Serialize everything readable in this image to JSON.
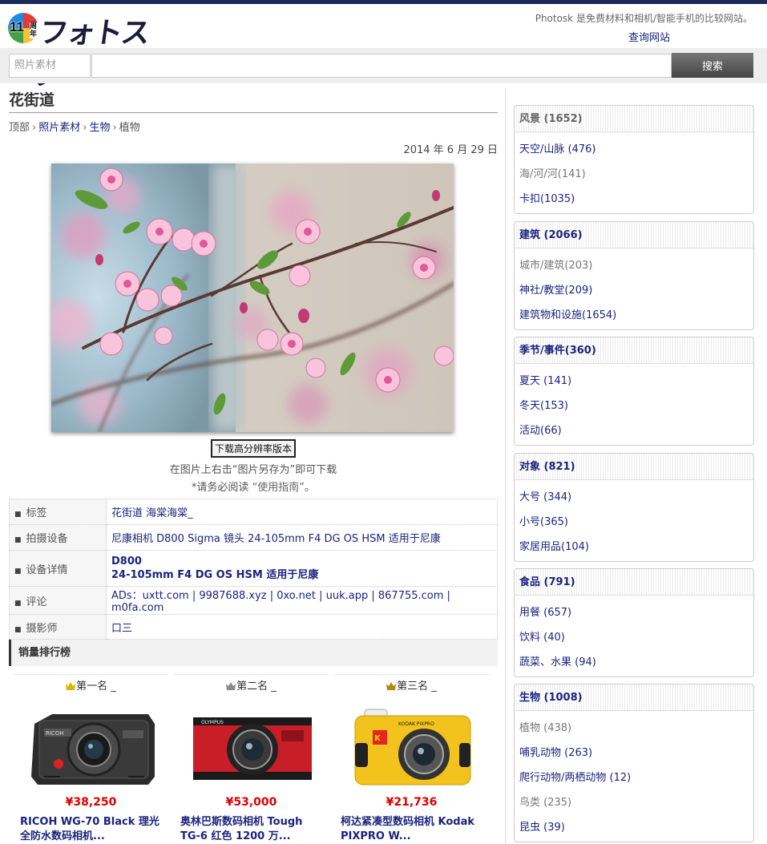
{
  "header": {
    "logo_badge": "11",
    "logo_badge_suffix": "周年",
    "logo_text": "フォトスク",
    "tagline": "Photosk 是免费材料和相机/智能手机的比较网站。",
    "lookup_link": "查询网站"
  },
  "search": {
    "category": "照片素材",
    "placeholder": "",
    "button": "搜索"
  },
  "page": {
    "title": "花街道",
    "breadcrumb": [
      "顶部",
      "照片素材",
      "生物",
      "植物"
    ],
    "date": "2014 年 6 月 29 日",
    "download_button": "下载高分辨率版本",
    "download_note": "在图片上右击“图片另存为”即可下载",
    "usage_note_prefix": "*请务必阅读 ",
    "usage_note_link": "“使用指南”",
    "usage_note_suffix": "。"
  },
  "info_table": {
    "tags_label": "标签",
    "tags_value": "花街道 海棠海棠_",
    "equipment_label": "拍摄设备",
    "equipment_value": "尼康相机  D800   Sigma 镜头  24-105mm F4 DG OS HSM 适用于尼康",
    "details_label": "设备详情",
    "details_line1": "D800",
    "details_line2": "24-105mm F4 DG OS HSM 适用于尼康",
    "comment_label": "评论",
    "comment_value": "ADs：uxtt.com | 9987688.xyz | 0xo.net | uuk.app | 867755.com | m0fa.com",
    "photographer_label": "摄影师",
    "photographer_value": "口三"
  },
  "ranking": {
    "title": "销量排行榜",
    "items": [
      {
        "rank": "第一名 _",
        "crown_color": "#e0b400",
        "price": "¥38,250",
        "name": "RICOH WG-70 Black 理光全防水数码相机..."
      },
      {
        "rank": "第二名 _",
        "crown_color": "#8a8a8a",
        "price": "¥53,000",
        "name": "奥林巴斯数码相机 Tough TG-6 红色 1200 万..."
      },
      {
        "rank": "第三名 _",
        "crown_color": "#b8860b",
        "price": "¥21,736",
        "name": "柯达紧凑型数码相机 Kodak PIXPRO W..."
      }
    ]
  },
  "sidebar": {
    "categories": [
      {
        "title": "风景 (1652)",
        "gray": true,
        "items": [
          {
            "label": "天空/山脉 (476)",
            "gray": false
          },
          {
            "label": "海/河/河(141)",
            "gray": true
          },
          {
            "label": "卡扣(1035)",
            "gray": false
          }
        ]
      },
      {
        "title": "建筑 (2066)",
        "gray": false,
        "items": [
          {
            "label": "城市/建筑(203)",
            "gray": true
          },
          {
            "label": "神社/教堂(209)",
            "gray": false
          },
          {
            "label": "建筑物和设施(1654)",
            "gray": false
          }
        ]
      },
      {
        "title": "季节/事件(360)",
        "gray": false,
        "items": [
          {
            "label": "夏天 (141)",
            "gray": false
          },
          {
            "label": "冬天(153)",
            "gray": false
          },
          {
            "label": "活动(66)",
            "gray": false
          }
        ]
      },
      {
        "title": "对象 (821)",
        "gray": false,
        "items": [
          {
            "label": "大号 (344)",
            "gray": false
          },
          {
            "label": "小号(365)",
            "gray": false
          },
          {
            "label": "家居用品(104)",
            "gray": false
          }
        ]
      },
      {
        "title": "食品 (791)",
        "gray": false,
        "items": [
          {
            "label": "用餐 (657)",
            "gray": false
          },
          {
            "label": "饮料 (40)",
            "gray": false
          },
          {
            "label": "蔬菜、水果 (94)",
            "gray": false
          }
        ]
      },
      {
        "title": "生物 (1008)",
        "gray": false,
        "items": [
          {
            "label": "植物 (438)",
            "gray": true
          },
          {
            "label": "哺乳动物 (263)",
            "gray": false
          },
          {
            "label": "爬行动物/两栖动物 (12)",
            "gray": false
          },
          {
            "label": "鸟类 (235)",
            "gray": true
          },
          {
            "label": "昆虫 (39)",
            "gray": false
          }
        ]
      }
    ]
  }
}
